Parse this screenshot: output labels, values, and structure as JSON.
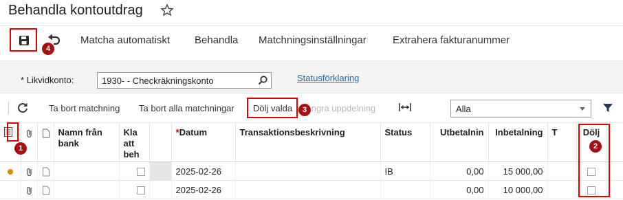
{
  "page": {
    "title": "Behandla kontoutdrag"
  },
  "toolbar": {
    "items": [
      "Matcha automatiskt",
      "Behandla",
      "Matchningsinställningar",
      "Extrahera fakturanummer"
    ]
  },
  "filter": {
    "account_label": "Likvidkonto:",
    "account_required_mark": "*",
    "account_value": "1930- - Checkräkningskonto",
    "status_link": "Statusförklaring"
  },
  "actions": {
    "remove_matching": "Ta bort matchning",
    "remove_all_matchings": "Ta bort alla matchningar",
    "hide_selected": "Dölj valda",
    "undo_split": "Ångra uppdelning",
    "filter_value": "Alla"
  },
  "grid": {
    "columns": {
      "name_from_bank": "Namn från bank",
      "ready": "Kla att beh",
      "date": "Datum",
      "description": "Transaktionsbeskrivning",
      "status": "Status",
      "payment": "Utbetalnin",
      "deposit": "Inbetalning",
      "t": "T",
      "hide": "Dölj"
    },
    "rows": [
      {
        "date": "2025-02-26",
        "status": "IB",
        "payment": "0,00",
        "deposit": "15 000,00"
      },
      {
        "date": "2025-02-26",
        "status": "",
        "payment": "0,00",
        "deposit": "10 000,00"
      }
    ]
  },
  "annotations": {
    "badge_1": "1",
    "badge_2": "2",
    "badge_3": "3",
    "badge_4": "4"
  },
  "colors": {
    "annotation_red": "#e00000",
    "badge_red": "#a61010",
    "link_blue": "#1a6ca8",
    "warning_orange": "#e08a00"
  },
  "icons": [
    "star-icon",
    "save-icon",
    "undo-icon",
    "magnifier-icon",
    "refresh-icon",
    "fit-columns-icon",
    "chevron-down-icon",
    "funnel-icon",
    "row-selector-icon",
    "attachment-icon",
    "document-icon",
    "warning-dot-icon"
  ]
}
